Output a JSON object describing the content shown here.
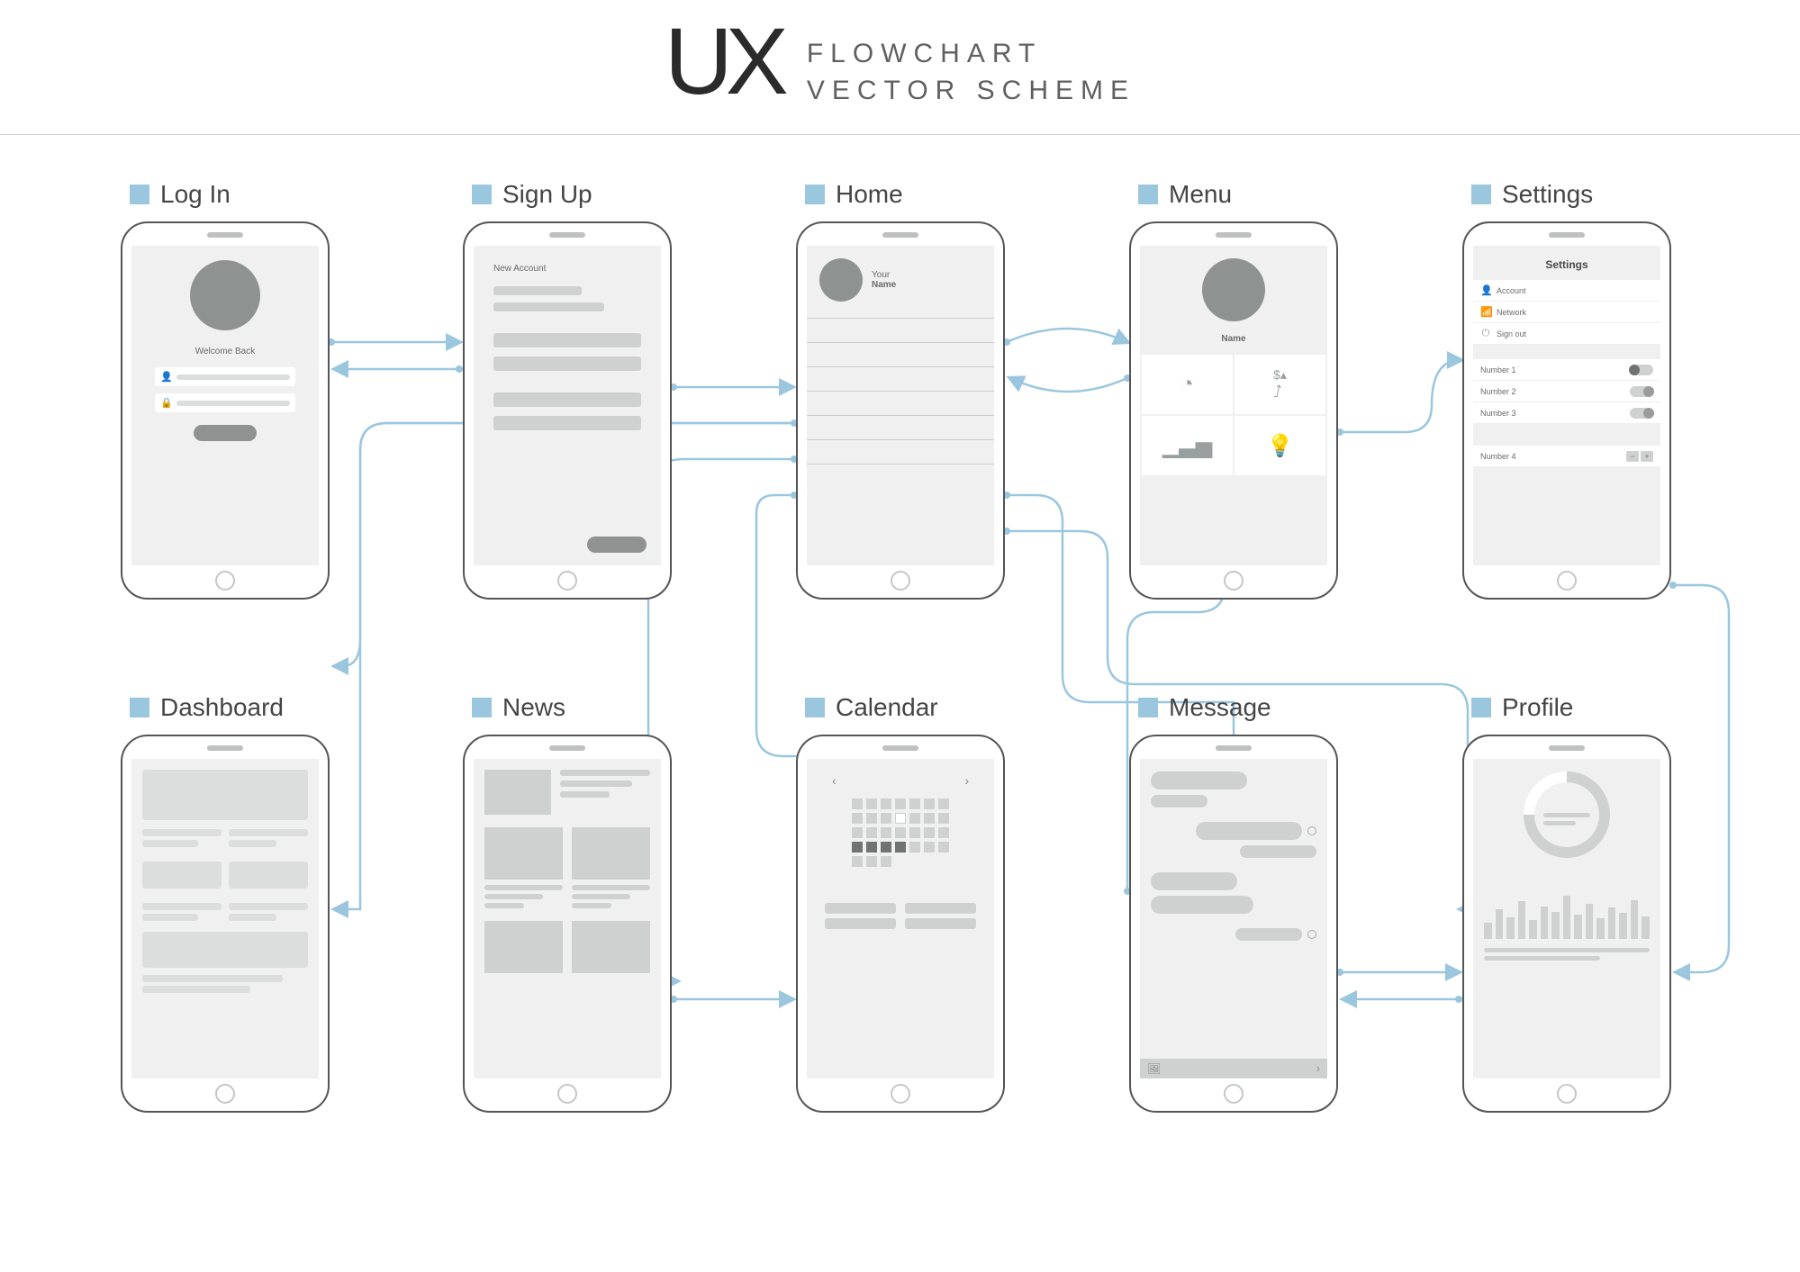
{
  "header": {
    "mark": "UX",
    "line1": "FLOWCHART",
    "line2": "VECTOR SCHEME"
  },
  "screens": {
    "login": {
      "label": "Log In",
      "welcome": "Welcome Back"
    },
    "signup": {
      "label": "Sign Up",
      "title": "New Account"
    },
    "home": {
      "label": "Home",
      "your": "Your",
      "name": "Name"
    },
    "menu": {
      "label": "Menu",
      "name": "Name",
      "tiles": {
        "a": "pie-chart-icon",
        "b": "trend-up-icon",
        "c": "bar-chart-icon",
        "d": "lightbulb-icon"
      }
    },
    "settings": {
      "label": "Settings",
      "title": "Settings",
      "items": [
        {
          "icon": "user-icon",
          "text": "Account"
        },
        {
          "icon": "wifi-icon",
          "text": "Network"
        },
        {
          "icon": "power-icon",
          "text": "Sign out"
        }
      ],
      "toggles": [
        {
          "text": "Number 1"
        },
        {
          "text": "Number 2"
        },
        {
          "text": "Number 3"
        }
      ],
      "stepper": {
        "text": "Number 4"
      }
    },
    "dashboard": {
      "label": "Dashboard"
    },
    "news": {
      "label": "News"
    },
    "calendar": {
      "label": "Calendar"
    },
    "message": {
      "label": "Message"
    },
    "profile": {
      "label": "Profile"
    }
  },
  "connections": [
    [
      "login",
      "signup"
    ],
    [
      "signup",
      "home"
    ],
    [
      "home",
      "menu"
    ],
    [
      "menu",
      "settings"
    ],
    [
      "home",
      "dashboard"
    ],
    [
      "home",
      "news"
    ],
    [
      "home",
      "calendar"
    ],
    [
      "home",
      "message"
    ],
    [
      "home",
      "profile"
    ],
    [
      "settings",
      "profile"
    ],
    [
      "message",
      "menu"
    ]
  ]
}
